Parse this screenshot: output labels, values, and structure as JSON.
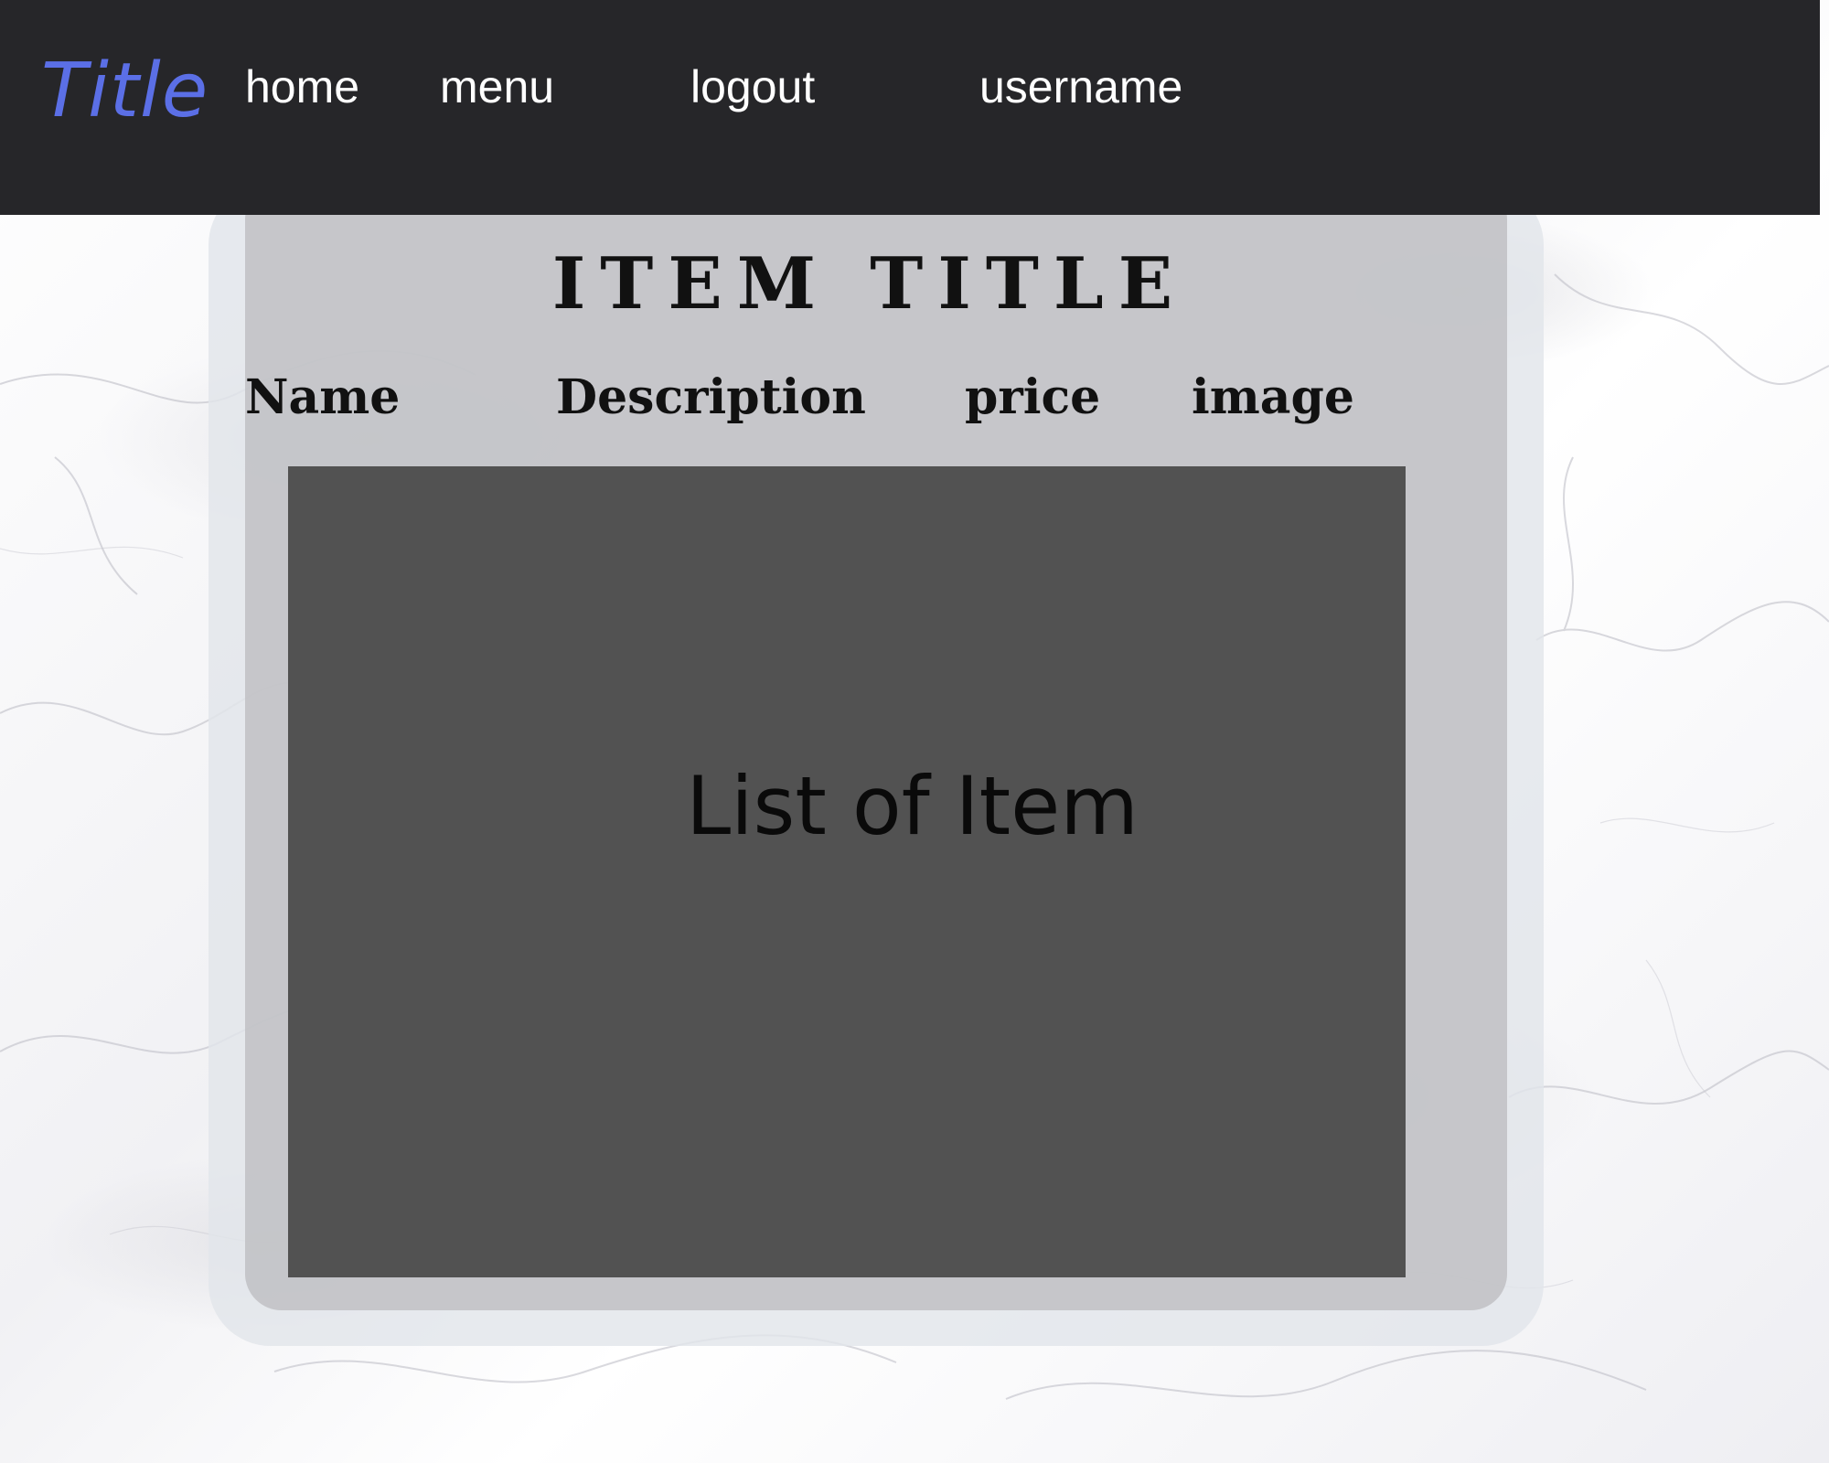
{
  "navbar": {
    "brand": "Title",
    "links": {
      "home": "home",
      "menu": "menu",
      "logout": "logout",
      "username": "username"
    },
    "background_color": "#262629",
    "brand_color": "#5b6fe6"
  },
  "main": {
    "title": "ITEM TITLE",
    "columns": {
      "name": "Name",
      "description": "Description",
      "price": "price",
      "image": "image"
    },
    "list_placeholder": "List of Item",
    "list_panel_color": "#525252"
  }
}
